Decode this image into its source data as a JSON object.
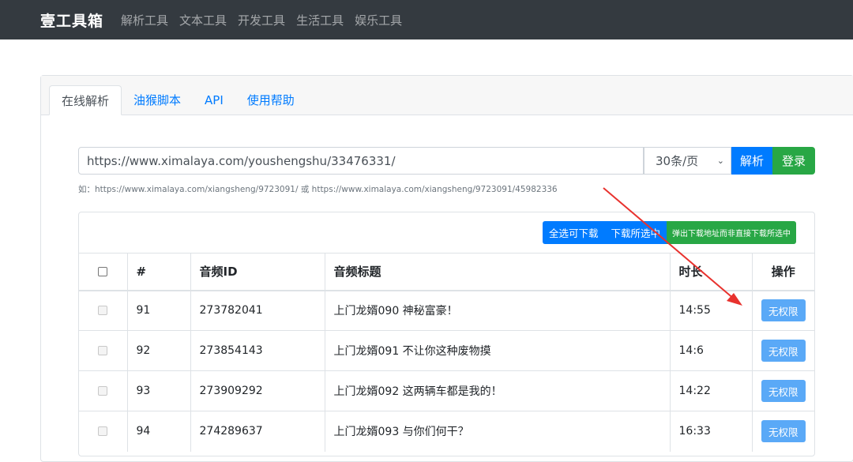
{
  "navbar": {
    "brand": "壹工具箱",
    "links": [
      "解析工具",
      "文本工具",
      "开发工具",
      "生活工具",
      "娱乐工具"
    ]
  },
  "tabs": [
    "在线解析",
    "油猴脚本",
    "API",
    "使用帮助"
  ],
  "form": {
    "url_value": "https://www.ximalaya.com/youshengshu/33476331/",
    "per_page": "30条/页",
    "parse_label": "解析",
    "login_label": "登录",
    "hint": "如：https://www.ximalaya.com/xiangsheng/9723091/ 或 https://www.ximalaya.com/xiangsheng/9723091/45982336"
  },
  "actions": {
    "select_all": "全选可下载",
    "download_selected": "下载所选中",
    "popup_download": "弹出下载地址而非直接下载所选中"
  },
  "table": {
    "headers": {
      "num": "#",
      "id": "音频ID",
      "title": "音频标题",
      "duration": "时长",
      "op": "操作"
    },
    "rows": [
      {
        "num": "91",
        "id": "273782041",
        "title": "上门龙婿090 神秘富豪！",
        "duration": "14:55",
        "op": "无权限"
      },
      {
        "num": "92",
        "id": "273854143",
        "title": "上门龙婿091 不让你这种废物摸",
        "duration": "14:6",
        "op": "无权限"
      },
      {
        "num": "93",
        "id": "273909292",
        "title": "上门龙婿092 这两辆车都是我的！",
        "duration": "14:22",
        "op": "无权限"
      },
      {
        "num": "94",
        "id": "274289637",
        "title": "上门龙婿093 与你们何干？",
        "duration": "16:33",
        "op": "无权限"
      }
    ]
  },
  "colors": {
    "navbar": "#343a40",
    "primary": "#007bff",
    "success": "#28a745",
    "no_permission": "#5aa9f7",
    "annotation_arrow": "#e8322e"
  }
}
